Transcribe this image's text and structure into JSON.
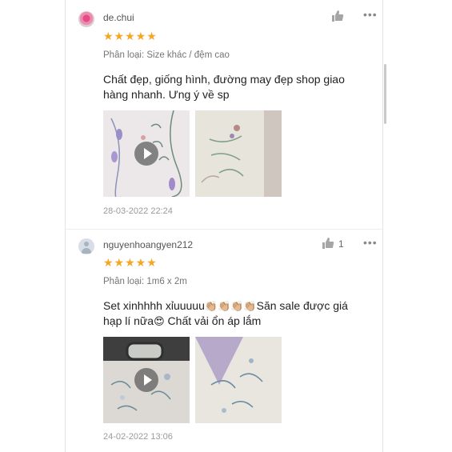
{
  "reviews": [
    {
      "username": "de.chui",
      "rating_display": "★★★★★",
      "rating": 5,
      "variant": "Phân loại: Size khác / đệm cao",
      "comment": "Chất đẹp, giống hình, đường may đẹp shop giao hàng nhanh. Ưng ý về sp",
      "date": "28-03-2022 22:24",
      "like_count": ""
    },
    {
      "username": "nguyenhoangyen212",
      "rating_display": "★★★★★",
      "rating": 5,
      "variant": "Phân loại: 1m6 x 2m",
      "comment_parts": [
        "Set xinhhhh xỉuuuuu",
        "👏🏼👏🏼👏🏼👏🏼",
        "Săn sale được giá hạp lí nữa",
        "😍",
        " Chất vải ổn áp lắm"
      ],
      "date": "24-02-2022 13:06",
      "like_count": "1"
    }
  ],
  "icons": {
    "like": "thumbs-up-icon",
    "more": "more-options-icon",
    "play": "play-icon"
  },
  "colors": {
    "stars": "#f5a623",
    "text_muted": "#9a9a9a"
  },
  "more_glyph": "•••"
}
